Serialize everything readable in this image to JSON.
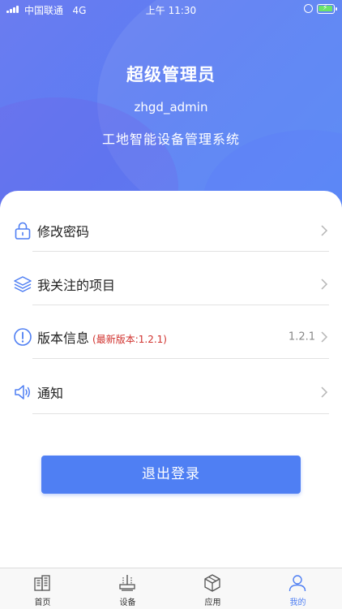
{
  "status_bar": {
    "carrier": "中国联通",
    "network": "4G",
    "time": "上午 11:30"
  },
  "profile": {
    "name": "超级管理员",
    "username": "zhgd_admin",
    "system": "工地智能设备管理系统"
  },
  "menu": {
    "items": [
      {
        "label": "修改密码",
        "icon": "lock-icon"
      },
      {
        "label": "我关注的项目",
        "icon": "layers-icon"
      },
      {
        "label": "版本信息",
        "note": "(最新版本:1.2.1)",
        "value": "1.2.1",
        "icon": "info-icon"
      },
      {
        "label": "通知",
        "icon": "speaker-icon"
      }
    ]
  },
  "logout_label": "退出登录",
  "tabs": [
    {
      "label": "首页",
      "icon": "building-icon"
    },
    {
      "label": "设备",
      "icon": "device-icon"
    },
    {
      "label": "应用",
      "icon": "box-icon"
    },
    {
      "label": "我的",
      "icon": "user-icon",
      "active": true
    }
  ],
  "colors": {
    "accent": "#4f7ff3",
    "note_red": "#d0312d",
    "header_start": "#6b7cf0",
    "header_end": "#4f86f5"
  }
}
